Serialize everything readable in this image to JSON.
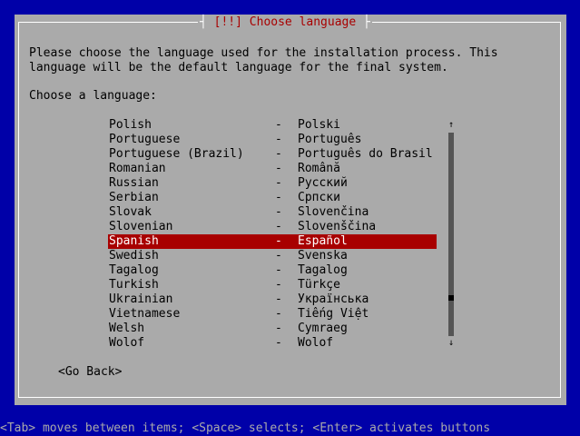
{
  "dialog": {
    "title": "[!!] Choose language",
    "prompt": "Please choose the language used for the installation process. This\nlanguage will be the default language for the final system.",
    "label": "Choose a language:",
    "go_back": "<Go Back>"
  },
  "languages": [
    {
      "name": "Polish",
      "dash": "-",
      "native": "Polski",
      "selected": false
    },
    {
      "name": "Portuguese",
      "dash": "-",
      "native": "Português",
      "selected": false
    },
    {
      "name": "Portuguese (Brazil)",
      "dash": "-",
      "native": "Português do Brasil",
      "selected": false
    },
    {
      "name": "Romanian",
      "dash": "-",
      "native": "Română",
      "selected": false
    },
    {
      "name": "Russian",
      "dash": "-",
      "native": "Русский",
      "selected": false
    },
    {
      "name": "Serbian",
      "dash": "-",
      "native": "Српски",
      "selected": false
    },
    {
      "name": "Slovak",
      "dash": "-",
      "native": "Slovenčina",
      "selected": false
    },
    {
      "name": "Slovenian",
      "dash": "-",
      "native": "Slovenščina",
      "selected": false
    },
    {
      "name": "Spanish",
      "dash": "-",
      "native": "Español",
      "selected": true
    },
    {
      "name": "Swedish",
      "dash": "-",
      "native": "Svenska",
      "selected": false
    },
    {
      "name": "Tagalog",
      "dash": "-",
      "native": "Tagalog",
      "selected": false
    },
    {
      "name": "Turkish",
      "dash": "-",
      "native": "Türkçe",
      "selected": false
    },
    {
      "name": "Ukrainian",
      "dash": "-",
      "native": "Українська",
      "selected": false
    },
    {
      "name": "Vietnamese",
      "dash": "-",
      "native": "Tiếng Việt",
      "selected": false
    },
    {
      "name": "Welsh",
      "dash": "-",
      "native": "Cymraeg",
      "selected": false
    },
    {
      "name": "Wolof",
      "dash": "-",
      "native": "Wolof",
      "selected": false
    }
  ],
  "scrollbar": {
    "up_arrow": "↑",
    "down_arrow": "↓"
  },
  "footer": {
    "help": "<Tab> moves between items; <Space> selects; <Enter> activates buttons"
  },
  "colors": {
    "background": "#0000a8",
    "dialog": "#aaaaaa",
    "title": "#a80000",
    "selection": "#a80000",
    "selection_text": "#ffffff"
  }
}
